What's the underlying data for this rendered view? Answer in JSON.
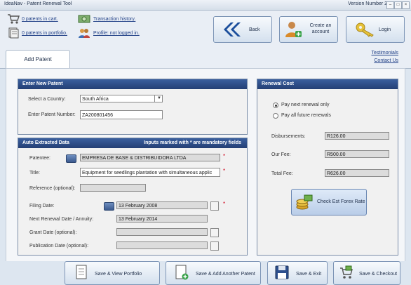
{
  "window": {
    "title": "IdeaNav - Patent Renewal Tool",
    "version": "Version Number 2.7.1",
    "controls": [
      "–",
      "□",
      "×"
    ]
  },
  "header": {
    "cart_link": "0 patents in cart.",
    "portfolio_link": "0 patents in portfolio.",
    "history_link": "Transaction history.",
    "profile_link": "Profile: not logged in.",
    "back_label": "Back",
    "create_label_1": "Create an",
    "create_label_2": "account",
    "login_label": "Login"
  },
  "tabs": {
    "active": "Add Patent",
    "testimonials": "Testimonials",
    "contact": "Contact Us"
  },
  "new_patent": {
    "title": "Enter New Patent",
    "country_label": "Select a Country:",
    "country_value": "South Africa",
    "number_label": "Enter Patent Number:",
    "number_value": "ZA200801456"
  },
  "auto": {
    "title": "Auto Extracted Data",
    "note": "Inputs marked with * are mandatory fields",
    "patentee_label": "Patentee:",
    "patentee_value": "EMPRESA DE BASE & DISTRIBUIDORA LTDA",
    "title_label": "Title:",
    "title_value": "Equipment for seedlings plantation with simultaneous applic",
    "reference_label": "Reference (optional):",
    "reference_value": "",
    "filing_label": "Filing Date:",
    "filing_value": "13 February 2008",
    "next_label": "Next Renewal Date / Annuity:",
    "next_value": "13 February 2014",
    "grant_label": "Grant Date (optional):",
    "grant_value": "",
    "pub_label": "Publication Date (optional):",
    "pub_value": "",
    "star": "*"
  },
  "renewal": {
    "title": "Renewal Cost",
    "option_next": "Pay next renewal only",
    "option_all": "Pay all future renewals",
    "disb_label": "Disbursements:",
    "disb_value": "R126.00",
    "fee_label": "Our Fee:",
    "fee_value": "R500.00",
    "total_label": "Total Fee:",
    "total_value": "R626.00",
    "forex_label": "Check Est Forex Rate"
  },
  "footer": {
    "save_view": "Save & View Portfolio",
    "save_add": "Save & Add Another Patent",
    "save_exit": "Save & Exit",
    "save_checkout": "Save & Checkout"
  },
  "colors": {
    "panel_header": "#2f4f88",
    "link": "#1f3f86",
    "mandatory": "#d0021b"
  }
}
